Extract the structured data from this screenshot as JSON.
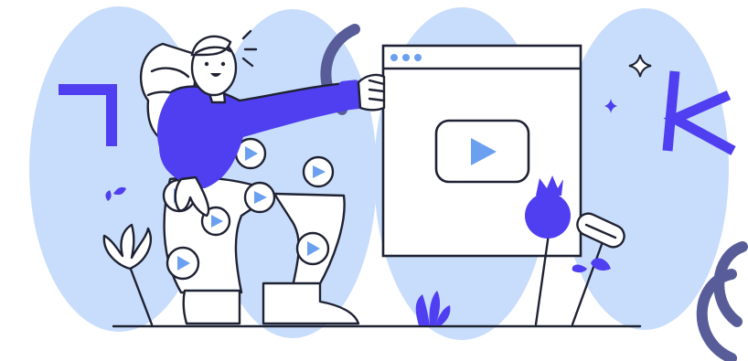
{
  "scene": {
    "background_color": "#ffffff",
    "blob_color": "#c8ddfb",
    "accent_color": "#4f3ff0",
    "play_color": "#6aa0ef",
    "outline_color": "#1f2233",
    "arc_color": "#585d99"
  },
  "decorative_glyphs": [
    "ʅ",
    "k"
  ],
  "icons": [
    "person-illustration",
    "browser-window-icon",
    "play-button-icon",
    "sparkle-icon",
    "flower-icon",
    "plant-icon",
    "decorative-arcs"
  ]
}
